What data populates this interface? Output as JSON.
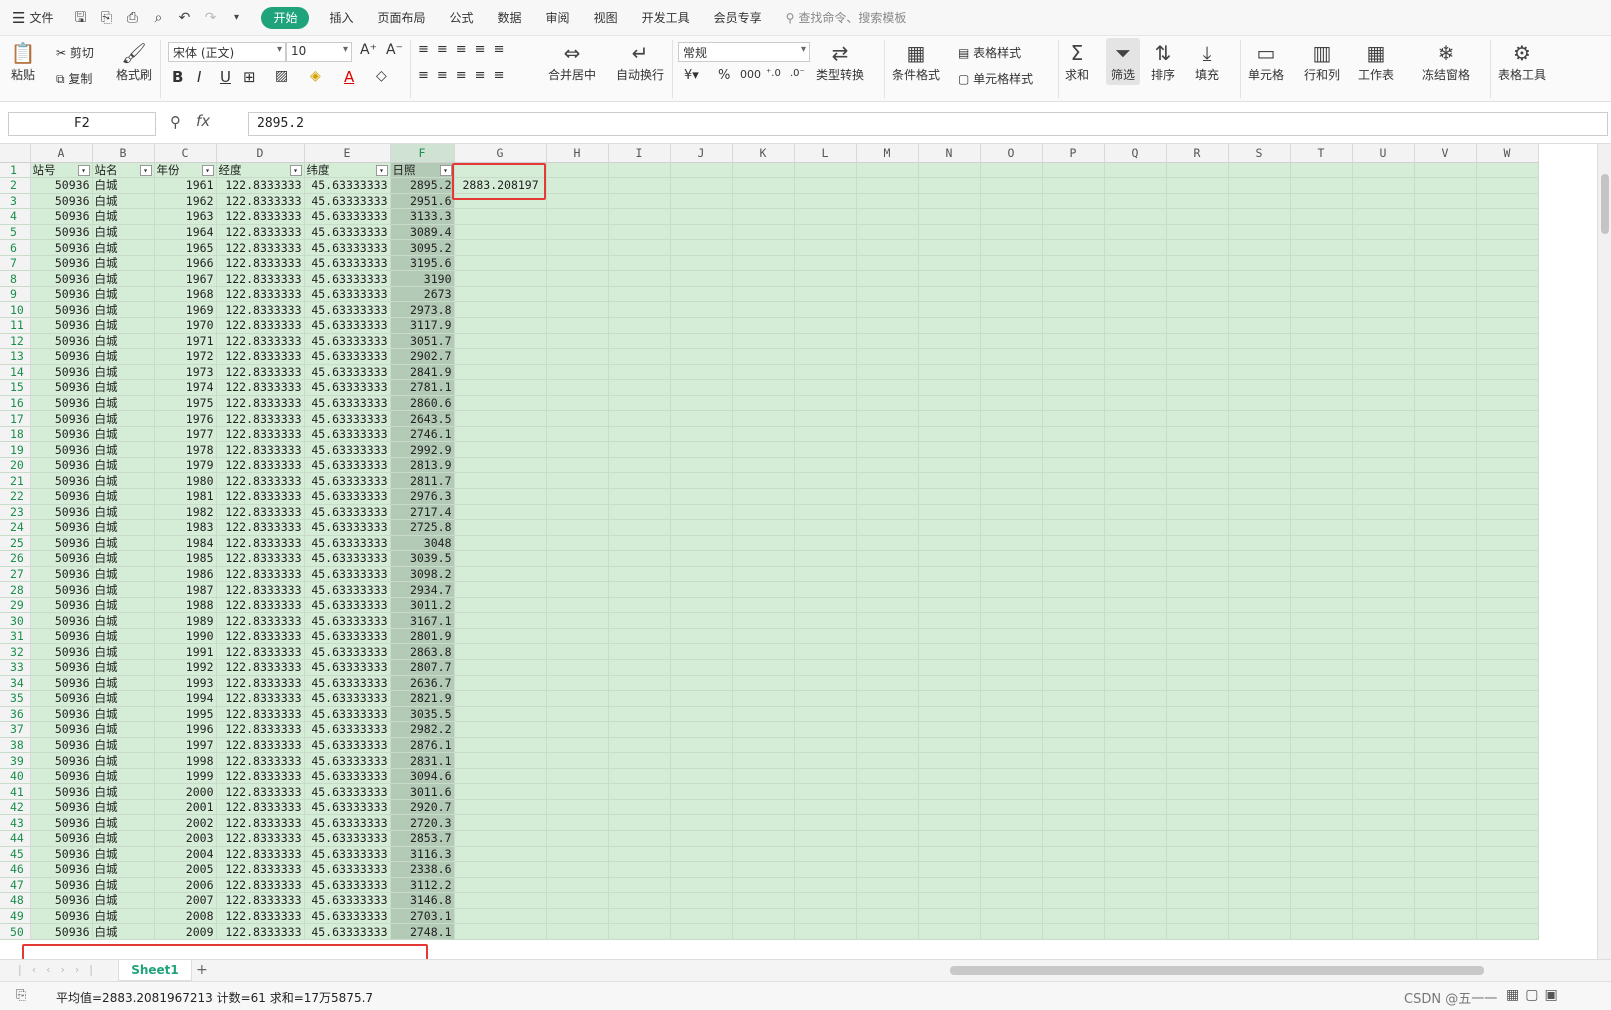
{
  "menubar": {
    "file": "文件",
    "tabs": [
      "开始",
      "插入",
      "页面布局",
      "公式",
      "数据",
      "审阅",
      "视图",
      "开发工具",
      "会员专享"
    ],
    "active_tab": "开始",
    "search_placeholder": "查找命令、搜索模板"
  },
  "ribbon": {
    "paste": "粘贴",
    "cut": "剪切",
    "copy": "复制",
    "format_painter": "格式刷",
    "font_name": "宋体 (正文)",
    "font_size": "10",
    "merge_center": "合并居中",
    "wrap_text": "自动换行",
    "number_format": "常规",
    "type_convert": "类型转换",
    "cond_format": "条件格式",
    "table_style": "表格样式",
    "cell_style": "单元格样式",
    "sum": "求和",
    "filter": "筛选",
    "sort": "排序",
    "fill": "填充",
    "cell": "单元格",
    "row_col": "行和列",
    "worksheet": "工作表",
    "freeze": "冻结窗格",
    "table_tools": "表格工具"
  },
  "formula_bar": {
    "name_box": "F2",
    "fx": "fx",
    "value": "2895.2"
  },
  "columns": [
    "A",
    "B",
    "C",
    "D",
    "E",
    "F",
    "G",
    "H",
    "I",
    "J",
    "K",
    "L",
    "M",
    "N",
    "O",
    "P",
    "Q",
    "R",
    "S",
    "T",
    "U",
    "V",
    "W"
  ],
  "headers": [
    "站号",
    "站名",
    "年份",
    "经度",
    "纬度",
    "日照"
  ],
  "station_id": "50936",
  "station_name": "白城",
  "longitude": "122.8333333",
  "latitude": "45.63333333",
  "years": [
    "1961",
    "1962",
    "1963",
    "1964",
    "1965",
    "1966",
    "1967",
    "1968",
    "1969",
    "1970",
    "1971",
    "1972",
    "1973",
    "1974",
    "1975",
    "1976",
    "1977",
    "1978",
    "1979",
    "1980",
    "1981",
    "1982",
    "1983",
    "1984",
    "1985",
    "1986",
    "1987",
    "1988",
    "1989",
    "1990",
    "1991",
    "1992",
    "1993",
    "1994",
    "1995",
    "1996",
    "1997",
    "1998",
    "1999",
    "2000",
    "2001",
    "2002",
    "2003",
    "2004",
    "2005",
    "2006",
    "2007",
    "2008",
    "2009"
  ],
  "sunshine": [
    "2895.2",
    "2951.6",
    "3133.3",
    "3089.4",
    "3095.2",
    "3195.6",
    "3190",
    "2673",
    "2973.8",
    "3117.9",
    "3051.7",
    "2902.7",
    "2841.9",
    "2781.1",
    "2860.6",
    "2643.5",
    "2746.1",
    "2992.9",
    "2813.9",
    "2811.7",
    "2976.3",
    "2717.4",
    "2725.8",
    "3048",
    "3039.5",
    "3098.2",
    "2934.7",
    "3011.2",
    "3167.1",
    "2801.9",
    "2863.8",
    "2807.7",
    "2636.7",
    "2821.9",
    "3035.5",
    "2982.2",
    "2876.1",
    "2831.1",
    "3094.6",
    "3011.6",
    "2920.7",
    "2720.3",
    "2853.7",
    "3116.3",
    "2338.6",
    "3112.2",
    "3146.8",
    "2703.1",
    "2748.1"
  ],
  "g2_value": "2883.208197",
  "sheet_tab": "Sheet1",
  "status": {
    "text": "平均值=2883.2081967213  计数=61  求和=17万5875.7",
    "watermark": "CSDN @五一一"
  }
}
